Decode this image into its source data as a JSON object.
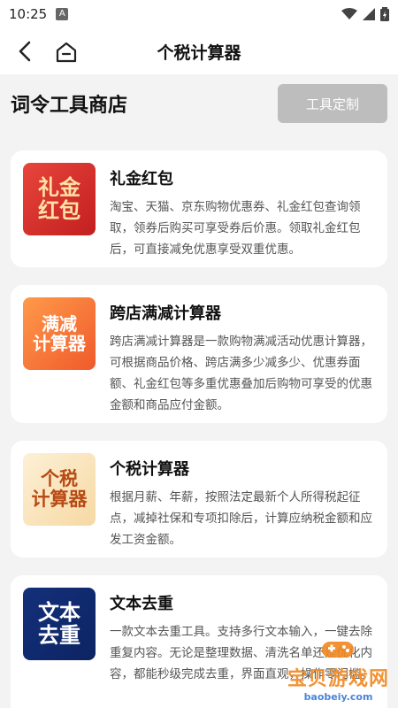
{
  "status": {
    "time": "10:25",
    "a_badge": "A"
  },
  "header": {
    "title": "个税计算器"
  },
  "store": {
    "title": "词令工具商店",
    "custom_button": "工具定制"
  },
  "cards": [
    {
      "title": "礼金红包",
      "icon_line1": "礼金",
      "icon_line2": "红包",
      "desc": "淘宝、天猫、京东购物优惠券、礼金红包查询领取，领券后购买可享受券后价惠。领取礼金红包后，可直接减免优惠享受双重优惠。"
    },
    {
      "title": "跨店满减计算器",
      "icon_line1": "满减",
      "icon_line2": "计算器",
      "desc": "跨店满减计算器是一款购物满减活动优惠计算器，可根据商品价格、跨店满多少减多少、优惠券面额、礼金红包等多重优惠叠加后购物可享受的优惠金额和商品应付金额。"
    },
    {
      "title": "个税计算器",
      "icon_line1": "个税",
      "icon_line2": "计算器",
      "desc": "根据月薪、年薪，按照法定最新个人所得税起征点，减掉社保和专项扣除后，计算应纳税金额和应发工资金额。"
    },
    {
      "title": "文本去重",
      "icon_line1": "文本",
      "icon_line2": "去重",
      "desc": "一款文本去重工具。支持多行文本输入，一键去除重复内容。无论是整理数据、清洗名单还是优化内容，都能秒级完成去重，界面直观，操作零门槛。"
    }
  ],
  "watermark": {
    "main": "宝贝游戏网",
    "sub": "baobeiy.com"
  },
  "colors": {
    "accent_gray": "#bdbdbd",
    "background": "#f3f3f3"
  }
}
